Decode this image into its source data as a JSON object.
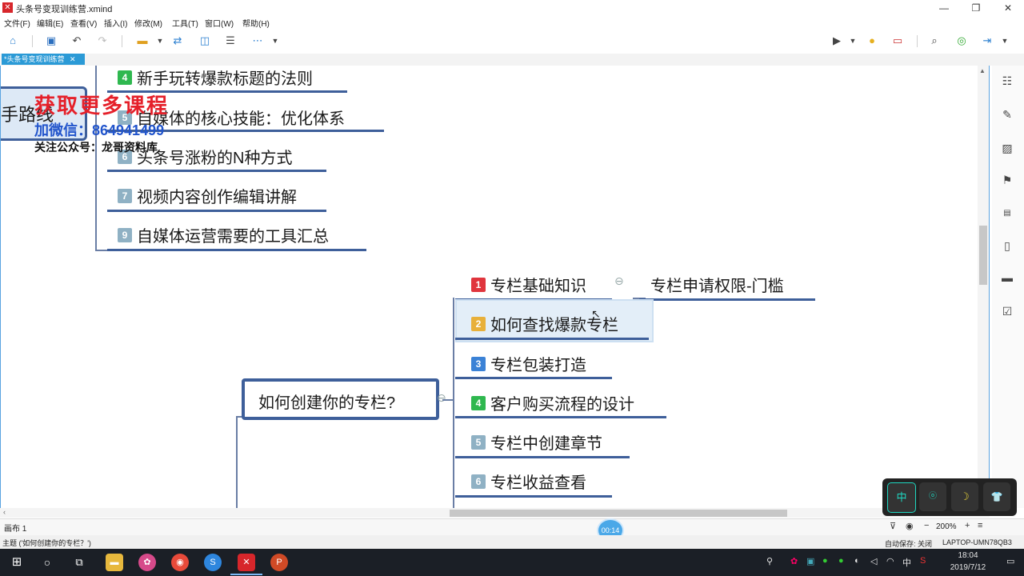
{
  "window": {
    "title": "头条号变现训练营.xmind",
    "app_icon": "xmind-icon",
    "controls": [
      "—",
      "❐",
      "✕"
    ]
  },
  "menu": [
    "文件(F)",
    "编辑(E)",
    "查看(V)",
    "插入(I)",
    "修改(M)",
    "工具(T)",
    "窗口(W)",
    "帮助(H)"
  ],
  "tab": {
    "label": "*头条号变现训练营",
    "close": "✕"
  },
  "watermark": {
    "line1": "获取更多课程",
    "line2": "加微信：864941499",
    "line3": "关注公众号：龙哥资料库",
    "partial_node": "手路线"
  },
  "top_branch": [
    {
      "num": "4",
      "label": "新手玩转爆款标题的法则"
    },
    {
      "num": "5",
      "label": "自媒体的核心技能：优化体系"
    },
    {
      "num": "6",
      "label": "头条号涨粉的N种方式"
    },
    {
      "num": "7",
      "label": "视频内容创作编辑讲解"
    },
    {
      "num": "9",
      "label": "自媒体运营需要的工具汇总"
    }
  ],
  "central": {
    "label": "如何创建你的专栏?",
    "collapse": "⊖"
  },
  "sub_topics": [
    {
      "num": "1",
      "label": "专栏基础知识",
      "color": "#e0353d"
    },
    {
      "num": "2",
      "label": "如何查找爆款专栏",
      "color": "#e8b03a"
    },
    {
      "num": "3",
      "label": "专栏包装打造",
      "color": "#3b82d6"
    },
    {
      "num": "4",
      "label": "客户购买流程的设计",
      "color": "#2fb84f"
    },
    {
      "num": "5",
      "label": "专栏中创建章节",
      "color": "#8fb1c4"
    },
    {
      "num": "6",
      "label": "专栏收益查看",
      "color": "#8fb1c4"
    }
  ],
  "child_of_1": {
    "label": "专栏申请权限-门槛",
    "collapse": "⊖"
  },
  "sheet": {
    "label": "画布 1"
  },
  "zoom": {
    "value": "200%",
    "minus": "−",
    "plus": "+"
  },
  "status": {
    "left": "主题 ('如何创建你的专栏？')",
    "autosave": "自动保存: 关闭",
    "machine": "LAPTOP-UMN78QB3"
  },
  "timer": "00:14",
  "taskbar": {
    "time": "18:04",
    "date": "2019/7/12",
    "ime": "中",
    "apps": [
      "windows-icon",
      "search-icon",
      "taskview-icon",
      "explorer-icon",
      "photos-icon",
      "chrome-icon",
      "sogou-icon",
      "xmind-icon",
      "powerpoint-icon"
    ]
  },
  "pad_keys": [
    "中",
    "ⓞ",
    "☽",
    "👕"
  ],
  "colors": {
    "accent": "#2b9ad6",
    "central_border": "#3e5f9a",
    "taskbar": "#1b1f26"
  }
}
